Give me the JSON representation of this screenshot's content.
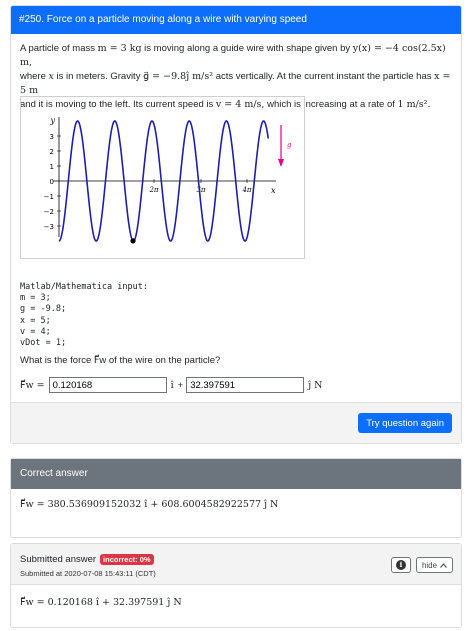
{
  "question": {
    "title": "#250. Force on a particle moving along a wire with varying speed",
    "text": {
      "s1": "A particle of mass ",
      "m_eq": "m = 3 kg",
      "s2": " is moving along a guide wire with shape given by ",
      "y_eq": "y(x) = −4 cos(2.5x) m,",
      "s3": "where ",
      "x_var": "x",
      "s4": " is in meters. Gravity ",
      "g_eq": "g⃗ = −9.8ĵ m/s²",
      "s5": " acts vertically. At the current instant the particle has ",
      "x_eq": "x = 5 m",
      "s6": "and it is moving to the left. Its current speed is ",
      "v_eq": "v = 4 m/s,",
      "s7": " which is increasing at a rate of ",
      "a_eq": "1 m/s².",
      "s8": ""
    },
    "plot": {
      "y_axis_label": "y",
      "x_axis_label": "x",
      "gravity_label": "g",
      "y_ticks": [
        "3",
        "2",
        "1",
        "0",
        "−1",
        "−2",
        "−3"
      ],
      "x_ticks": [
        "2π",
        "3π",
        "4π"
      ]
    },
    "code_block": "Matlab/Mathematica input:\nm = 3;\ng = -9.8;\nx = 5;\nv = 4;\nvDot = 1;",
    "prompt": "What is the force F⃗w of the wire on the particle?",
    "answer": {
      "label": "F⃗w =",
      "i_value": "0.120168",
      "plus": "+",
      "i_unit": "î",
      "j_value": "32.397591",
      "j_unit": "ĵ N"
    },
    "try_again_label": "Try question again"
  },
  "correct_answer": {
    "header": "Correct answer",
    "expression": "F⃗w = 380.536909152032 î + 608.6004582922577 ĵ N"
  },
  "submitted_answer": {
    "header": "Submitted answer",
    "badge": "incorrect: 0%",
    "timestamp": "Submitted at 2020-07-08 15:43:11 (CDT)",
    "info_icon": "info-circle",
    "hide_label": "hide",
    "expression": "F⃗w = 0.120168 î + 32.397591 ĵ N"
  },
  "colors": {
    "primary": "#0d6efd",
    "secondary": "#6c757d",
    "danger": "#dc3545",
    "curve": "#1f1fa8",
    "gravity_arrow": "#e0008a"
  }
}
